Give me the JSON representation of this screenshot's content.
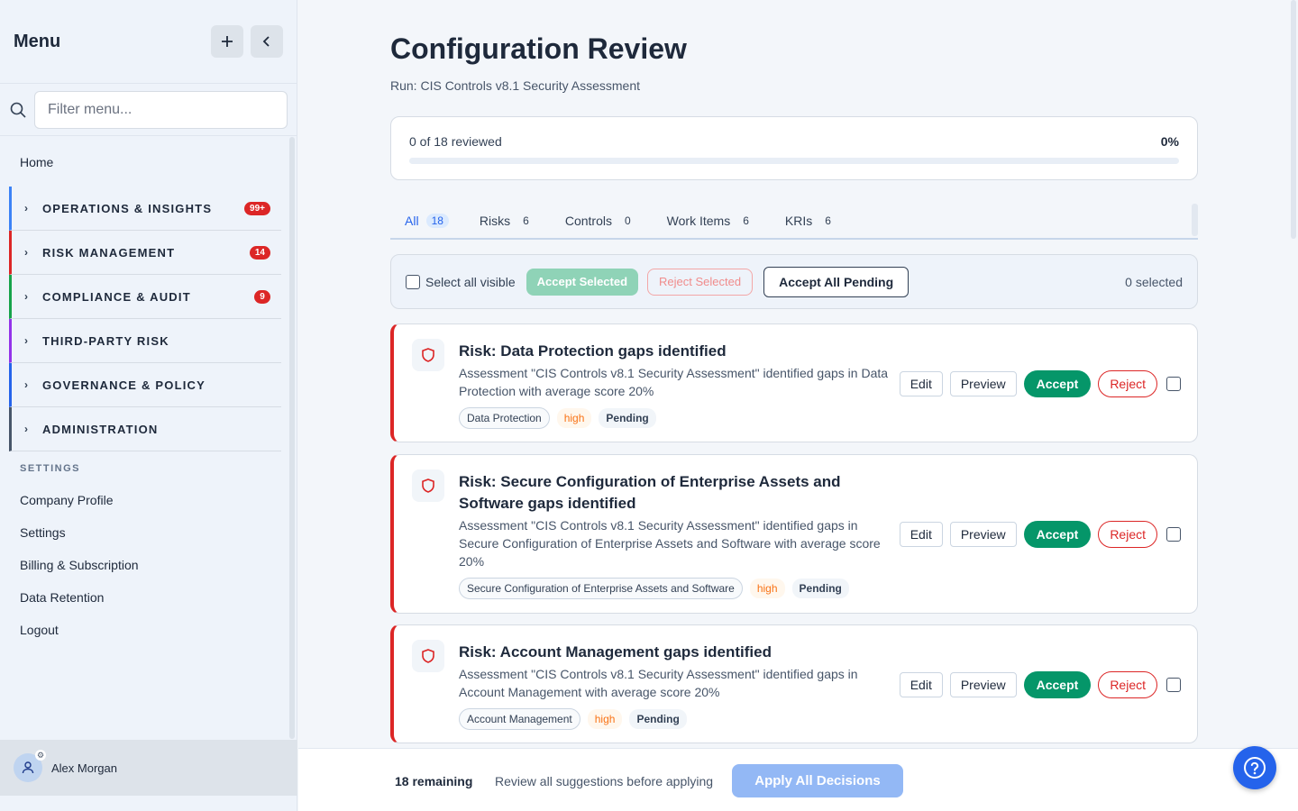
{
  "sidebar": {
    "title": "Menu",
    "add_icon": "plus-icon",
    "collapse_icon": "chevron-left-icon",
    "filter_placeholder": "Filter menu...",
    "home": "Home",
    "groups": [
      {
        "label": "OPERATIONS & INSIGHTS",
        "badge": "99+",
        "color": "#3b82f6"
      },
      {
        "label": "RISK MANAGEMENT",
        "badge": "14",
        "color": "#dc2626"
      },
      {
        "label": "COMPLIANCE & AUDIT",
        "badge": "9",
        "color": "#16a34a"
      },
      {
        "label": "THIRD-PARTY RISK",
        "badge": "",
        "color": "#9333ea"
      },
      {
        "label": "GOVERNANCE & POLICY",
        "badge": "",
        "color": "#2563eb"
      },
      {
        "label": "ADMINISTRATION",
        "badge": "",
        "color": "#475569"
      }
    ],
    "settings_label": "SETTINGS",
    "settings_links": [
      "Company Profile",
      "Settings",
      "Billing & Subscription",
      "Data Retention",
      "Logout"
    ],
    "user_name": "Alex Morgan"
  },
  "header": {
    "title": "Configuration Review",
    "run": "Run: CIS Controls v8.1 Security Assessment"
  },
  "progress": {
    "text": "0 of 18 reviewed",
    "percent_label": "0%",
    "value": 0
  },
  "tabs": [
    {
      "label": "All",
      "count": "18",
      "active": true
    },
    {
      "label": "Risks",
      "count": "6"
    },
    {
      "label": "Controls",
      "count": "0"
    },
    {
      "label": "Work Items",
      "count": "6"
    },
    {
      "label": "KRIs",
      "count": "6"
    }
  ],
  "toolbar": {
    "select_all": "Select all visible",
    "accept_selected": "Accept Selected",
    "reject_selected": "Reject Selected",
    "accept_all": "Accept All Pending",
    "selected_count": "0 selected"
  },
  "actions": {
    "edit": "Edit",
    "preview": "Preview",
    "accept": "Accept",
    "reject": "Reject"
  },
  "items": [
    {
      "title": "Risk: Data Protection gaps identified",
      "description": "Assessment \"CIS Controls v8.1 Security Assessment\" identified gaps in Data Protection with average score 20%",
      "area": "Data Protection",
      "severity": "high",
      "status": "Pending"
    },
    {
      "title": "Risk: Secure Configuration of Enterprise Assets and Software gaps identified",
      "description": "Assessment \"CIS Controls v8.1 Security Assessment\" identified gaps in Secure Configuration of Enterprise Assets and Software with average score 20%",
      "area": "Secure Configuration of Enterprise Assets and Software",
      "severity": "high",
      "status": "Pending"
    },
    {
      "title": "Risk: Account Management gaps identified",
      "description": "Assessment \"CIS Controls v8.1 Security Assessment\" identified gaps in Account Management with average score 20%",
      "area": "Account Management",
      "severity": "high",
      "status": "Pending"
    }
  ],
  "footer": {
    "remaining": "18 remaining",
    "hint": "Review all suggestions before applying",
    "apply": "Apply All Decisions"
  },
  "help_icon": "help-circle-icon"
}
